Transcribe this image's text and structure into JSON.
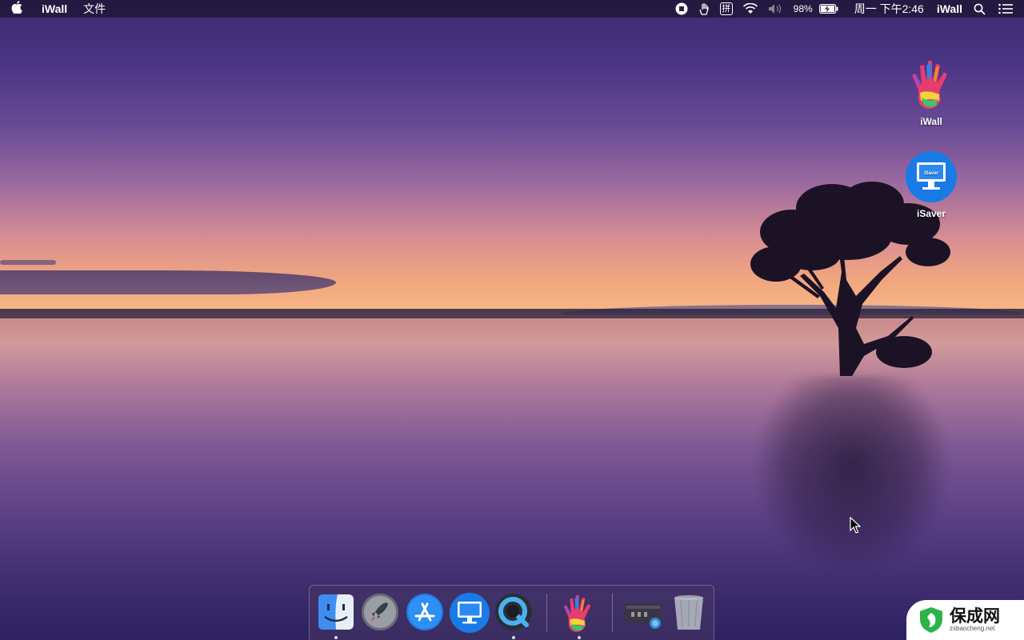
{
  "menubar": {
    "app_name": "iWall",
    "menu_file": "文件",
    "battery_percent": "98%",
    "clock": "周一 下午2:46",
    "status_app": "iWall",
    "input_method_glyph": "拼"
  },
  "desktop": {
    "icons": [
      {
        "label": "iWall"
      },
      {
        "label": "iSaver"
      }
    ],
    "isaver_screen_text": "iSaver"
  },
  "dock": {
    "items": [
      {
        "name": "Finder",
        "running": true
      },
      {
        "name": "Launchpad",
        "running": false
      },
      {
        "name": "App Store",
        "running": false
      },
      {
        "name": "iSaver",
        "running": false
      },
      {
        "name": "QuickTime Player",
        "running": true
      },
      {
        "name": "iWall",
        "running": true
      },
      {
        "name": "Screenshot stack",
        "running": false
      },
      {
        "name": "Trash",
        "running": false
      }
    ]
  },
  "watermark": {
    "cn": "保成网",
    "url": "zsbaocheng.net"
  },
  "colors": {
    "menubar_bg": "#1e1637",
    "isaver_blue": "#1a7ae6",
    "finder_blue": "#3d8ef0"
  }
}
